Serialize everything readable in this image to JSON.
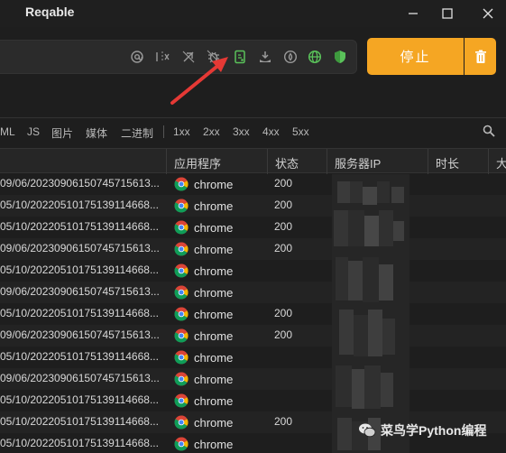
{
  "window": {
    "title": "Reqable"
  },
  "toolbar": {
    "icons": [
      "at-icon",
      "filter-toggle-icon",
      "breakpoint-off-icon",
      "debug-bug-icon",
      "script-icon",
      "download-icon",
      "cloud-drop-icon",
      "globe-icon",
      "shield-icon"
    ],
    "stop_label": "停止"
  },
  "filters": {
    "items": [
      "ML",
      "JS",
      "图片",
      "媒体",
      "二进制",
      "1xx",
      "2xx",
      "3xx",
      "4xx",
      "5xx"
    ]
  },
  "table": {
    "columns": [
      "应用程序",
      "状态",
      "服务器IP",
      "时长",
      "大"
    ],
    "rows": [
      {
        "url": "09/06/20230906150745715613...",
        "app": "chrome",
        "status": "200"
      },
      {
        "url": "05/10/20220510175139114668...",
        "app": "chrome",
        "status": "200"
      },
      {
        "url": "05/10/20220510175139114668...",
        "app": "chrome",
        "status": "200"
      },
      {
        "url": "09/06/20230906150745715613...",
        "app": "chrome",
        "status": "200"
      },
      {
        "url": "05/10/20220510175139114668...",
        "app": "chrome",
        "status": ""
      },
      {
        "url": "09/06/20230906150745715613...",
        "app": "chrome",
        "status": ""
      },
      {
        "url": "05/10/20220510175139114668...",
        "app": "chrome",
        "status": "200"
      },
      {
        "url": "09/06/20230906150745715613...",
        "app": "chrome",
        "status": "200"
      },
      {
        "url": "05/10/20220510175139114668...",
        "app": "chrome",
        "status": ""
      },
      {
        "url": "09/06/20230906150745715613...",
        "app": "chrome",
        "status": ""
      },
      {
        "url": "05/10/20220510175139114668...",
        "app": "chrome",
        "status": ""
      },
      {
        "url": "05/10/20220510175139114668...",
        "app": "chrome",
        "status": "200"
      },
      {
        "url": "05/10/20220510175139114668...",
        "app": "chrome",
        "status": ""
      }
    ]
  },
  "watermark": {
    "text": "菜鸟学Python编程"
  },
  "colors": {
    "accent": "#f5a623",
    "background": "#1e1e1e",
    "annotation_arrow": "#e53935"
  }
}
